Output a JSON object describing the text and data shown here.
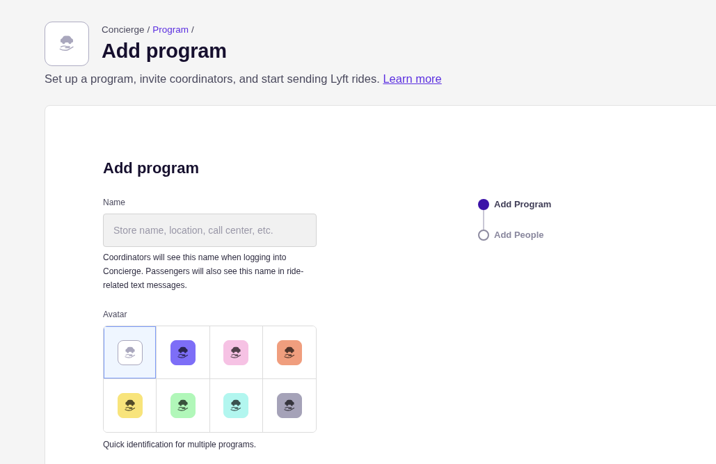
{
  "header": {
    "breadcrumb": [
      {
        "label": "Concierge",
        "kind": "text"
      },
      {
        "label": "/",
        "kind": "separator"
      },
      {
        "label": "Program",
        "kind": "link"
      },
      {
        "label": "/",
        "kind": "separator"
      }
    ],
    "title": "Add program",
    "description": {
      "text": "Set up a program, invite coordinators, and start sending Lyft rides.",
      "link": "Learn more"
    }
  },
  "form": {
    "title": "Add program",
    "name_field": {
      "label": "Name",
      "placeholder": "Store name, location, call center, etc.",
      "help": "Coordinators will see this name when logging into Concierge. Passengers will also see this name in ride-related text messages."
    },
    "avatar_field": {
      "label": "Avatar",
      "options": [
        {
          "kind": "outline",
          "color": "#a9a7bd",
          "selected": true
        },
        {
          "kind": "filled",
          "color": "#7d6ef7",
          "selected": false
        },
        {
          "kind": "filled",
          "color": "#f6c2e4",
          "selected": false
        },
        {
          "kind": "filled",
          "color": "#f09e7e",
          "selected": false
        },
        {
          "kind": "filled",
          "color": "#f8e47b",
          "selected": false
        },
        {
          "kind": "filled",
          "color": "#b1f7b9",
          "selected": false
        },
        {
          "kind": "filled",
          "color": "#b2f6ef",
          "selected": false
        },
        {
          "kind": "filled",
          "color": "#a5a2b8",
          "selected": false
        }
      ],
      "help": "Quick identification for multiple programs."
    }
  },
  "stepper": {
    "steps": [
      {
        "label": "Add Program",
        "selected": true
      },
      {
        "label": "Add People",
        "selected": false
      }
    ]
  }
}
